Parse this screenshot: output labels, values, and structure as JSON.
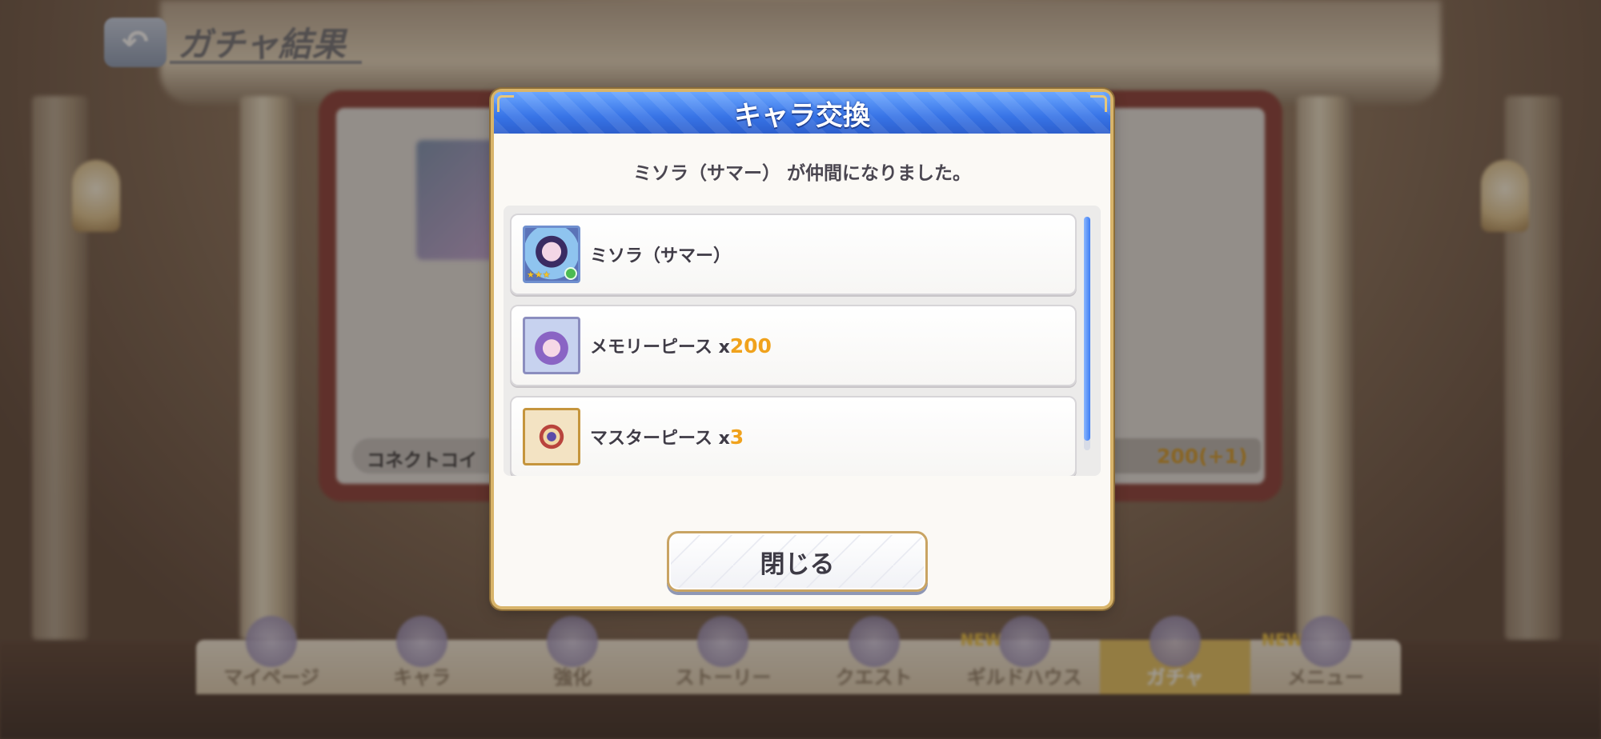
{
  "header": {
    "back_icon": "↶",
    "title": "ガチャ結果"
  },
  "background": {
    "coin_label": "コネクトコイ",
    "coin_count": "200(+1)"
  },
  "nav": {
    "items": [
      {
        "label": "マイページ",
        "new": ""
      },
      {
        "label": "キャラ",
        "new": ""
      },
      {
        "label": "強化",
        "new": ""
      },
      {
        "label": "ストーリー",
        "new": ""
      },
      {
        "label": "クエスト",
        "new": ""
      },
      {
        "label": "ギルドハウス",
        "new": "NEW"
      },
      {
        "label": "ガチャ",
        "new": "",
        "active": true
      },
      {
        "label": "メニュー",
        "new": "NEW"
      }
    ]
  },
  "modal": {
    "title": "キャラ交換",
    "message": "ミソラ（サマー） が仲間になりました。",
    "items": [
      {
        "label": "ミソラ（サマー）",
        "x": "",
        "qty": "",
        "icon": "character-portrait-icon",
        "stars": "★★★"
      },
      {
        "label": "メモリーピース ",
        "x": "x",
        "qty": "200",
        "icon": "memory-piece-icon"
      },
      {
        "label": "マスターピース ",
        "x": "x",
        "qty": "3",
        "icon": "master-piece-icon"
      }
    ],
    "close_label": "閉じる",
    "colors": {
      "header_blue": "#3773e6",
      "quantity_orange": "#f0a21c",
      "frame_gold": "#d8b46a"
    }
  }
}
